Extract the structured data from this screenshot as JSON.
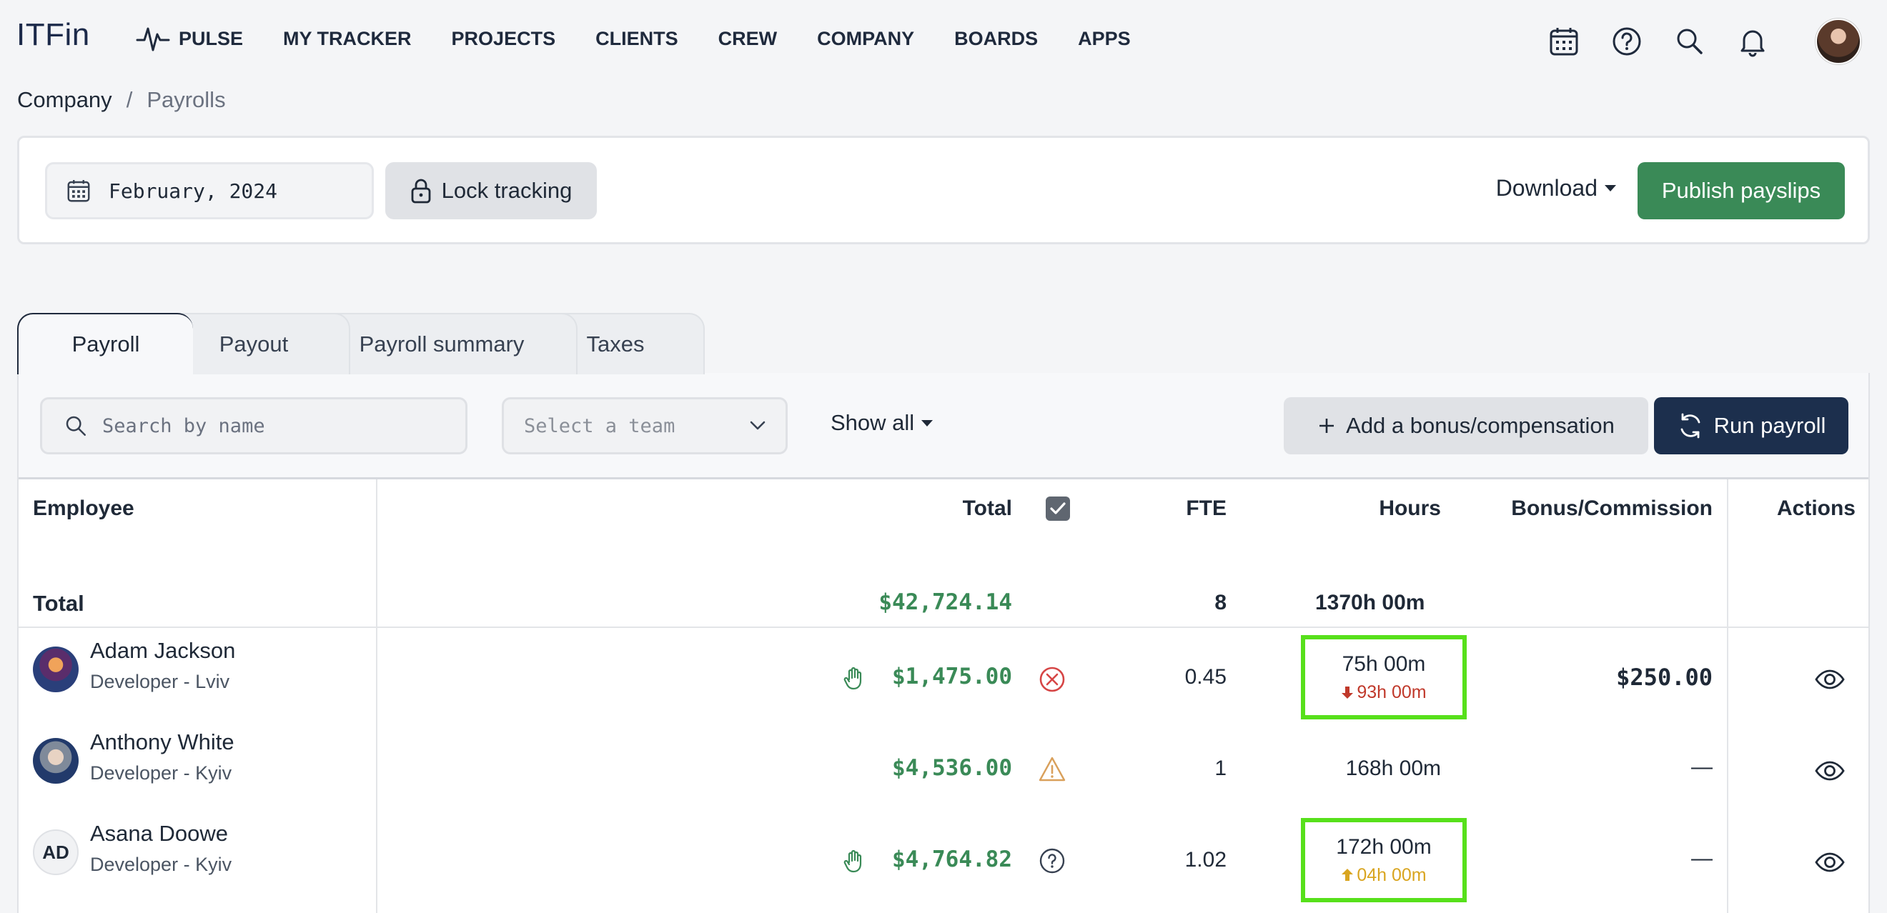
{
  "app": {
    "logo": "ITFin"
  },
  "nav": {
    "items": [
      {
        "label": "PULSE",
        "icon": "pulse-icon"
      },
      {
        "label": "MY TRACKER"
      },
      {
        "label": "PROJECTS"
      },
      {
        "label": "CLIENTS"
      },
      {
        "label": "CREW"
      },
      {
        "label": "COMPANY"
      },
      {
        "label": "BOARDS"
      },
      {
        "label": "APPS"
      }
    ],
    "right_icons": [
      "calendar-icon",
      "help-icon",
      "search-icon",
      "bell-icon",
      "user-avatar"
    ]
  },
  "breadcrumb": {
    "parent": "Company",
    "separator": "/",
    "current": "Payrolls"
  },
  "toolbar": {
    "period": "February, 2024",
    "lock_label": "Lock tracking",
    "download_label": "Download",
    "publish_label": "Publish payslips"
  },
  "tabs": [
    {
      "label": "Payroll",
      "active": true
    },
    {
      "label": "Payout",
      "active": false
    },
    {
      "label": "Payroll summary",
      "active": false
    },
    {
      "label": "Taxes",
      "active": false
    }
  ],
  "filters": {
    "search_placeholder": "Search by name",
    "team_placeholder": "Select a team",
    "show_all_label": "Show all",
    "bonus_label": "Add a bonus/compensation",
    "run_label": "Run payroll"
  },
  "table": {
    "headers": {
      "employee": "Employee",
      "total": "Total",
      "fte": "FTE",
      "hours": "Hours",
      "bonus": "Bonus/Commission",
      "actions": "Actions"
    },
    "totals": {
      "label": "Total",
      "total": "$42,724.14",
      "fte": "8",
      "hours": "1370h 00m"
    },
    "rows": [
      {
        "name": "Adam Jackson",
        "role": "Developer - Lviv",
        "avatar": "photo",
        "manual": true,
        "total": "$1,475.00",
        "status": "error",
        "fte": "0.45",
        "hours": "75h 00m",
        "hours_diff": "93h 00m",
        "diff_dir": "down",
        "highlight": true,
        "bonus": "$250.00"
      },
      {
        "name": "Anthony White",
        "role": "Developer - Kyiv",
        "avatar": "photo",
        "manual": false,
        "total": "$4,536.00",
        "status": "warning",
        "fte": "1",
        "hours": "168h 00m",
        "hours_diff": "",
        "diff_dir": "",
        "highlight": false,
        "bonus": "—"
      },
      {
        "name": "Asana Doowe",
        "role": "Developer - Kyiv",
        "avatar": "AD",
        "manual": true,
        "total": "$4,764.82",
        "status": "question",
        "fte": "1.02",
        "hours": "172h 00m",
        "hours_diff": "04h 00m",
        "diff_dir": "up",
        "highlight": true,
        "bonus": "—"
      }
    ]
  },
  "colors": {
    "money_green": "#3a8a57",
    "publish_green": "#3a8a57",
    "navy": "#1c2f4d",
    "highlight_green": "#57e01b",
    "diff_down": "#c0392b",
    "diff_up": "#d9a520"
  }
}
